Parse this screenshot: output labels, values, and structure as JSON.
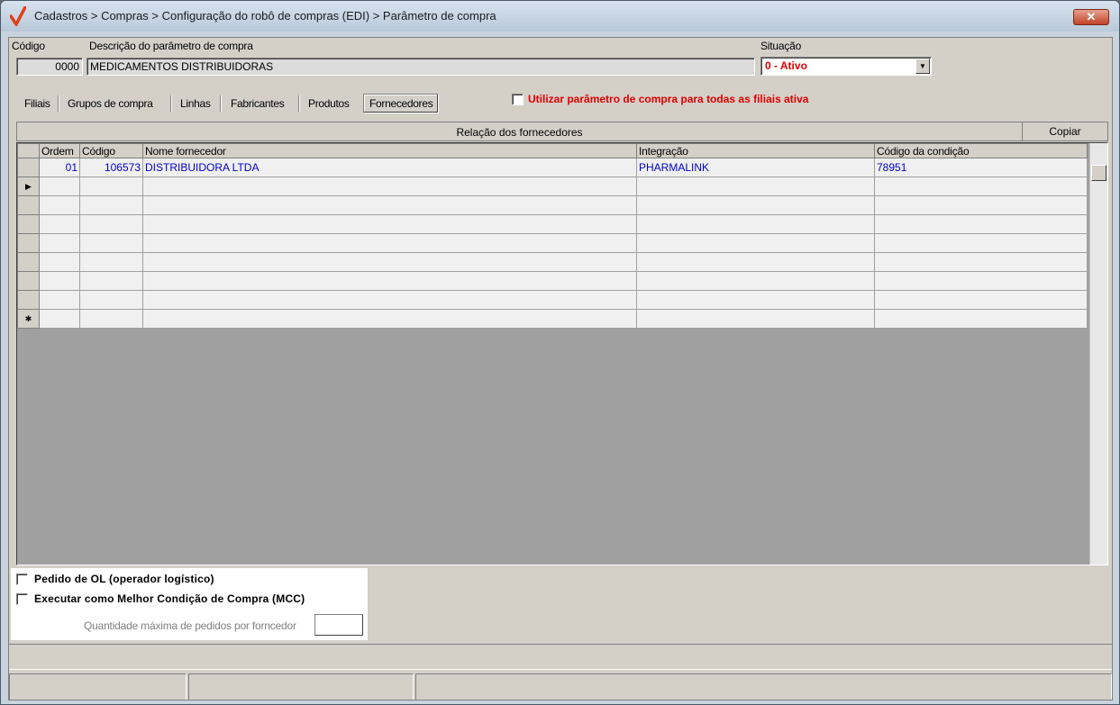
{
  "window": {
    "title": "Cadastros > Compras > Configuração do robô de compras (EDI) > Parâmetro de compra",
    "close_label": "✕"
  },
  "form": {
    "codigo_label": "Código",
    "codigo_value": "0000",
    "descricao_label": "Descrição do parâmetro de compra",
    "descricao_value": "MEDICAMENTOS DISTRIBUIDORAS",
    "situacao_label": "Situação",
    "situacao_value": "0 - Ativo"
  },
  "tabs": [
    {
      "label": "Filiais"
    },
    {
      "label": "Grupos de compra"
    },
    {
      "label": "Linhas"
    },
    {
      "label": "Fabricantes"
    },
    {
      "label": "Produtos"
    },
    {
      "label": "Fornecedores"
    }
  ],
  "active_tab": "Fornecedores",
  "all_branches_checkbox": {
    "label": "Utilizar parâmetro de compra para todas as filiais ativa",
    "checked": false
  },
  "grid": {
    "title": "Relação dos fornecedores",
    "copy_button": "Copiar",
    "columns": [
      "Ordem",
      "Código",
      "Nome fornecedor",
      "Integração",
      "Código da condição"
    ],
    "rows": [
      {
        "ordem": "01",
        "codigo": "106573",
        "nome": "DISTRIBUIDORA  LTDA",
        "integracao": "PHARMALINK",
        "condicao": "78951"
      }
    ],
    "indicator_current": "▶",
    "indicator_new": "✱"
  },
  "options": {
    "pedido_ol_label": "Pedido de OL (operador logístico)",
    "pedido_ol_checked": false,
    "mcc_label": "Executar como Melhor Condição de Compra (MCC)",
    "mcc_checked": false,
    "max_pedidos_label": "Quantidade máxima de pedidos por forncedor",
    "max_pedidos_value": ""
  },
  "colors": {
    "accent_red": "#e00000",
    "grid_text_blue": "#0000d0"
  }
}
